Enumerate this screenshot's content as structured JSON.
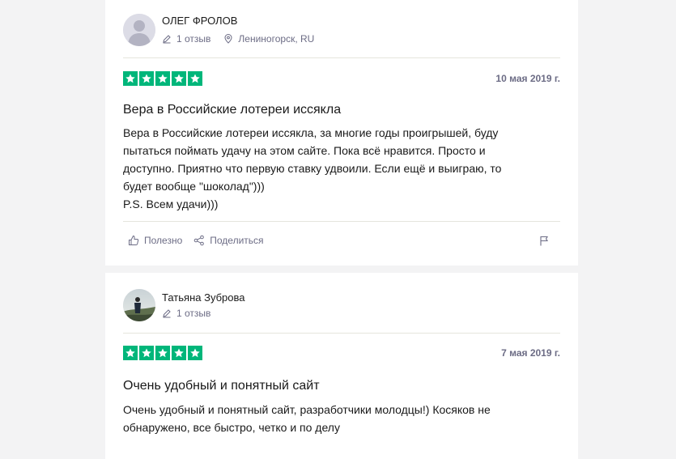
{
  "reviews": [
    {
      "author": "ОЛЕГ ФРОЛОВ",
      "reviews_count": "1 отзыв",
      "location": "Лениногорск, RU",
      "rating": 5,
      "date": "10 мая 2019 г.",
      "title": "Вера в Российские лотереи иссякла",
      "body": "Вера в Российские лотереи иссякла, за многие годы проигрышей, буду\nпытаться поймать удачу на этом сайте. Пока всё нравится. Просто и\nдоступно. Приятно что первую ставку удвоили. Если ещё и выиграю, то\nбудет вообще \"шоколад\")))\nP.S. Всем удачи)))",
      "useful_label": "Полезно",
      "share_label": "Поделиться"
    },
    {
      "author": "Татьяна Зуброва",
      "reviews_count": "1 отзыв",
      "rating": 5,
      "date": "7 мая 2019 г.",
      "title": "Очень удобный и понятный сайт",
      "body": "Очень удобный и понятный сайт, разработчики молодцы!) Косяков не\nобнаружено, все быстро, четко и по делу"
    }
  ],
  "colors": {
    "star_green": "#00b67a",
    "muted": "#6c6c85"
  }
}
